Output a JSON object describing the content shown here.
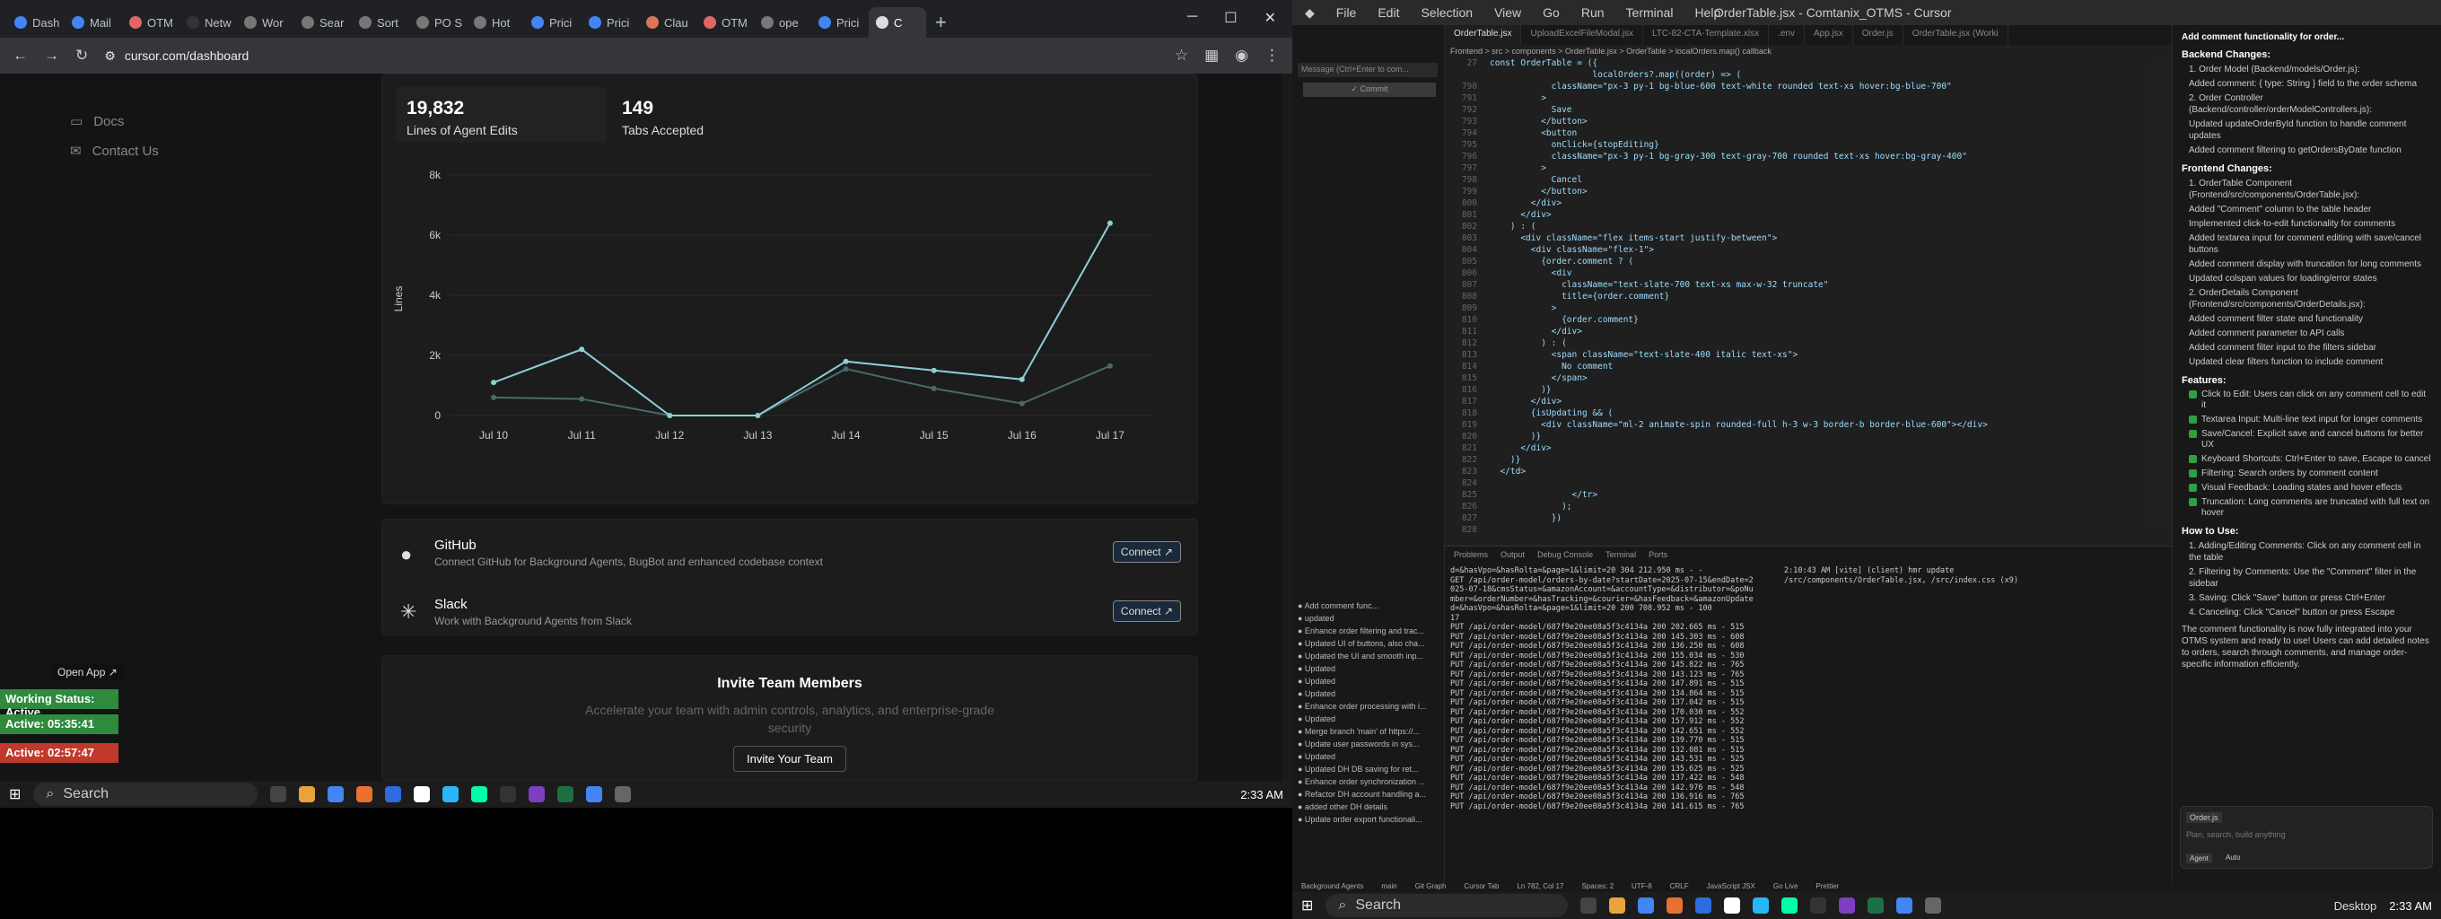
{
  "browser": {
    "tabs": [
      "Dash",
      "Mail",
      "OTM",
      "Netw",
      "Wor",
      "Sear",
      "Sort",
      "PO S",
      "Hot",
      "Prici",
      "Prici",
      "Clau",
      "OTM",
      "ope",
      "Prici",
      "C"
    ],
    "tab_colors": [
      "#4285f4",
      "#4285f4",
      "#e06666",
      "#333",
      "#777",
      "#777",
      "#777",
      "#777",
      "#777",
      "#4285f4",
      "#4285f4",
      "#d97757",
      "#e06666",
      "#777",
      "#4285f4",
      "#ddd"
    ],
    "url": "cursor.com/dashboard"
  },
  "dashboard": {
    "nav": [
      "Docs",
      "Contact Us"
    ],
    "stats": [
      {
        "value": "19,832",
        "label": "Lines of Agent Edits"
      },
      {
        "value": "149",
        "label": "Tabs Accepted"
      }
    ],
    "chart_ylabel": "Lines",
    "integrations": [
      {
        "name": "GitHub",
        "desc": "Connect GitHub for Background Agents, BugBot and enhanced codebase context",
        "btn": "Connect"
      },
      {
        "name": "Slack",
        "desc": "Work with Background Agents from Slack",
        "btn": "Connect"
      }
    ],
    "invite": {
      "title": "Invite Team Members",
      "text": "Accelerate your team with admin controls, analytics, and enterprise-grade security",
      "btn": "Invite Your Team"
    }
  },
  "chart_data": {
    "type": "line",
    "categories": [
      "Jul 10",
      "Jul 11",
      "Jul 12",
      "Jul 13",
      "Jul 14",
      "Jul 15",
      "Jul 16",
      "Jul 17"
    ],
    "ylabel": "Lines",
    "ylim": [
      0,
      8000
    ],
    "yticks": [
      "0",
      "2k",
      "4k",
      "6k",
      "8k"
    ],
    "series": [
      {
        "values": [
          1100,
          2200,
          0,
          0,
          1800,
          1500,
          1200,
          6400
        ],
        "color": "#8ecfd8"
      },
      {
        "values": [
          600,
          550,
          0,
          0,
          1550,
          900,
          400,
          1650
        ],
        "color": "#4a6a6a"
      }
    ]
  },
  "overlay": {
    "open_app": "Open App ↗",
    "working_status": "Working Status: Active",
    "active1": "Active: 05:35:41",
    "active2": "Active: 02:57:47"
  },
  "taskbar": {
    "search": "Search",
    "time_left": "2:33 AM",
    "time_right": "2:33 AM",
    "desktop": "Desktop"
  },
  "cursor": {
    "menu": [
      "File",
      "Edit",
      "Selection",
      "View",
      "Go",
      "Run",
      "Terminal",
      "Help"
    ],
    "title": "OrderTable.jsx - Comtanix_OTMS - Cursor",
    "tabs": [
      "OrderTable.jsx",
      "UploadExcelFileModal.jsx",
      "LTC-82-CTA-Template.xlsx",
      ".env",
      "App.jsx",
      "Order.js",
      "OrderTable.jsx (Worki"
    ],
    "breadcrumb": "Frontend > src > components > OrderTable.jsx > OrderTable > localOrders.map() callback",
    "code_lines": [
      [
        "27",
        "const OrderTable = ({"
      ],
      [
        "",
        "                    localOrders?.map((order) => ("
      ],
      [
        "790",
        "            className=\"px-3 py-1 bg-blue-600 text-white rounded text-xs hover:bg-blue-700\""
      ],
      [
        "791",
        "          >"
      ],
      [
        "792",
        "            Save"
      ],
      [
        "793",
        "          </button>"
      ],
      [
        "794",
        "          <button"
      ],
      [
        "795",
        "            onClick={stopEditing}"
      ],
      [
        "796",
        "            className=\"px-3 py-1 bg-gray-300 text-gray-700 rounded text-xs hover:bg-gray-400\""
      ],
      [
        "797",
        "          >"
      ],
      [
        "798",
        "            Cancel"
      ],
      [
        "799",
        "          </button>"
      ],
      [
        "800",
        "        </div>"
      ],
      [
        "801",
        "      </div>"
      ],
      [
        "802",
        "    ) : ("
      ],
      [
        "803",
        "      <div className=\"flex items-start justify-between\">"
      ],
      [
        "804",
        "        <div className=\"flex-1\">"
      ],
      [
        "805",
        "          {order.comment ? ("
      ],
      [
        "806",
        "            <div"
      ],
      [
        "807",
        "              className=\"text-slate-700 text-xs max-w-32 truncate\""
      ],
      [
        "808",
        "              title={order.comment}"
      ],
      [
        "809",
        "            >"
      ],
      [
        "810",
        "              {order.comment}"
      ],
      [
        "811",
        "            </div>"
      ],
      [
        "812",
        "          ) : ("
      ],
      [
        "813",
        "            <span className=\"text-slate-400 italic text-xs\">"
      ],
      [
        "814",
        "              No comment"
      ],
      [
        "815",
        "            </span>"
      ],
      [
        "816",
        "          )}"
      ],
      [
        "817",
        "        </div>"
      ],
      [
        "818",
        "        {isUpdating && ("
      ],
      [
        "819",
        "          <div className=\"ml-2 animate-spin rounded-full h-3 w-3 border-b border-blue-600\"></div>"
      ],
      [
        "820",
        "        )}"
      ],
      [
        "821",
        "      </div>"
      ],
      [
        "822",
        "    )}"
      ],
      [
        "823",
        "  </td>"
      ],
      [
        "824",
        ""
      ],
      [
        "825",
        "                </tr>"
      ],
      [
        "826",
        "              );"
      ],
      [
        "827",
        "            })"
      ],
      [
        "828",
        ""
      ]
    ],
    "panel_tabs": [
      "Problems",
      "Output",
      "Debug Console",
      "Terminal",
      "Ports"
    ],
    "terminal_lines": [
      "d=&hasVpo=&hasRolta=&page=1&limit=20 304 212.950 ms - -",
      "GET /api/order-model/orders-by-date?startDate=2025-07-15&endDate=2",
      "025-07-18&cmsStatus=&amazonAccount=&accountType=&distributor=&poNu",
      "mber=&orderNumber=&hasTracking=&courier=&hasFeedback=&amazonUpdate",
      "d=&hasVpo=&hasRolta=&page=1&limit=20 200 708.952 ms - 100",
      "17",
      "PUT /api/order-model/687f9e20ee08a5f3c4134a 200 202.665 ms - 515",
      "PUT /api/order-model/687f9e20ee08a5f3c4134a 200 145.303 ms - 608",
      "PUT /api/order-model/687f9e20ee08a5f3c4134a 200 136.250 ms - 608",
      "PUT /api/order-model/687f9e20ee08a5f3c4134a 200 155.034 ms - 530",
      "PUT /api/order-model/687f9e20ee08a5f3c4134a 200 145.822 ms - 765",
      "PUT /api/order-model/687f9e20ee08a5f3c4134a 200 143.123 ms - 765",
      "PUT /api/order-model/687f9e20ee08a5f3c4134a 200 147.891 ms - 515",
      "PUT /api/order-model/687f9e20ee08a5f3c4134a 200 134.864 ms - 515",
      "PUT /api/order-model/687f9e20ee08a5f3c4134a 200 137.042 ms - 515",
      "PUT /api/order-model/687f9e20ee08a5f3c4134a 200 170.030 ms - 552",
      "PUT /api/order-model/687f9e20ee08a5f3c4134a 200 157.912 ms - 552",
      "PUT /api/order-model/687f9e20ee08a5f3c4134a 200 142.651 ms - 552",
      "PUT /api/order-model/687f9e20ee08a5f3c4134a 200 139.770 ms - 515",
      "PUT /api/order-model/687f9e20ee08a5f3c4134a 200 132.081 ms - 515",
      "PUT /api/order-model/687f9e20ee08a5f3c4134a 200 143.531 ms - 525",
      "PUT /api/order-model/687f9e20ee08a5f3c4134a 200 135.625 ms - 525",
      "PUT /api/order-model/687f9e20ee08a5f3c4134a 200 137.422 ms - 548",
      "PUT /api/order-model/687f9e20ee08a5f3c4134a 200 142.976 ms - 548",
      "PUT /api/order-model/687f9e20ee08a5f3c4134a 200 136.916 ms - 765",
      "PUT /api/order-model/687f9e20ee08a5f3c4134a 200 141.615 ms - 765"
    ],
    "vite_line": "2:10:43 AM [vite] (client) hmr update /src/components/OrderTable.jsx, /src/index.css (x9)",
    "git_log": [
      "Add comment func...",
      "updated",
      "Enhance order filtering and trac...",
      "Updated UI of buttons, also cha...",
      "Updated the UI and smooth inp...",
      "Updated",
      "Updated",
      "Updated",
      "Enhance order processing with i...",
      "Updated",
      "Merge branch 'main' of https://...",
      "Update user passwords in sys...",
      "Updated",
      "Updated DH DB saving for ret...",
      "Enhance order synchronization ...",
      "Refactor DH account handling a...",
      "added other DH details",
      "Update order export functionali..."
    ],
    "chat": {
      "title": "Add comment functionality for order...",
      "backend_h": "Backend Changes:",
      "backend": [
        "1. Order Model (Backend/models/Order.js):",
        "Added comment: { type: String } field to the order schema",
        "2. Order Controller (Backend/controller/orderModelControllers.js):",
        "Updated updateOrderById function to handle comment updates",
        "Added comment filtering to getOrdersByDate function"
      ],
      "frontend_h": "Frontend Changes:",
      "frontend": [
        "1. OrderTable Component (Frontend/src/components/OrderTable.jsx):",
        "Added \"Comment\" column to the table header",
        "Implemented click-to-edit functionality for comments",
        "Added textarea input for comment editing with save/cancel buttons",
        "Added comment display with truncation for long comments",
        "Updated colspan values for loading/error states",
        "2. OrderDetails Component (Frontend/src/components/OrderDetails.jsx):",
        "Added comment filter state and functionality",
        "Added comment parameter to API calls",
        "Added comment filter input to the filters sidebar",
        "Updated clear filters function to include comment"
      ],
      "features_h": "Features:",
      "features": [
        "Click to Edit: Users can click on any comment cell to edit it",
        "Textarea Input: Multi-line text input for longer comments",
        "Save/Cancel: Explicit save and cancel buttons for better UX",
        "Keyboard Shortcuts: Ctrl+Enter to save, Escape to cancel",
        "Filtering: Search orders by comment content",
        "Visual Feedback: Loading states and hover effects",
        "Truncation: Long comments are truncated with full text on hover"
      ],
      "howto_h": "How to Use:",
      "howto": [
        "1. Adding/Editing Comments: Click on any comment cell in the table",
        "2. Filtering by Comments: Use the \"Comment\" filter in the sidebar",
        "3. Saving: Click \"Save\" button or press Ctrl+Enter",
        "4. Canceling: Click \"Cancel\" button or press Escape"
      ],
      "summary": "The comment functionality is now fully integrated into your OTMS system and ready to use! Users can add detailed notes to orders, search through comments, and manage order-specific information efficiently.",
      "input_placeholder": "Plan, search, build anything",
      "file_chip": "Order.js",
      "agent_label": "Agent",
      "auto_label": "Auto"
    },
    "statusbar": [
      "Background Agents",
      "main",
      "Git Graph",
      "Cursor Tab",
      "Ln 782, Col 17",
      "Spaces: 2",
      "UTF-8",
      "CRLF",
      "JavaScript JSX",
      "Go Live",
      "Prettier"
    ]
  }
}
